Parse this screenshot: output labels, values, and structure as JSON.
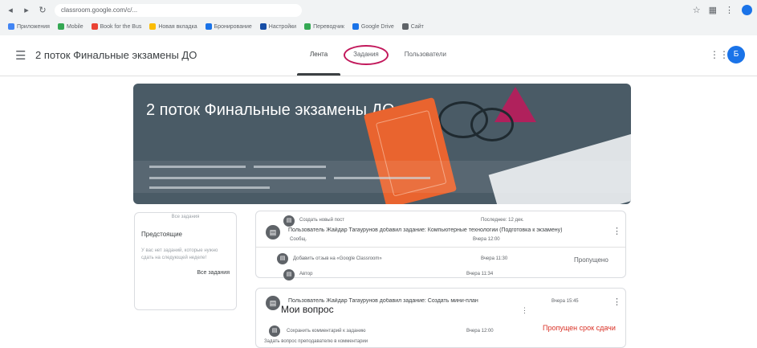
{
  "browser": {
    "url": "classroom.google.com/c/...",
    "bookmarks": [
      {
        "label": "Приложения",
        "color": "#4285f4"
      },
      {
        "label": "Mobile",
        "color": "#34a853"
      },
      {
        "label": "Book for the Bus",
        "color": "#ea4335"
      },
      {
        "label": "Новая вкладка",
        "color": "#fbbc04"
      },
      {
        "label": "Бронирование",
        "color": "#1a73e8"
      },
      {
        "label": "Настройки",
        "color": "#174ea6"
      },
      {
        "label": "Переводчик",
        "color": "#34a853"
      },
      {
        "label": "Google Drive",
        "color": "#1a73e8"
      },
      {
        "label": "Сайт",
        "color": "#5f6368"
      }
    ]
  },
  "header": {
    "course_title": "2 поток Финальные экзамены ДО",
    "tabs": [
      {
        "label": "Лента"
      },
      {
        "label": "Задания"
      },
      {
        "label": "Пользователи"
      }
    ],
    "avatar_letter": "Б"
  },
  "banner": {
    "title": "2 поток Финальные экзамены ДО"
  },
  "sidebar": {
    "top_label": "Все задания",
    "title": "Предстоящие",
    "text": "У вас нет заданий, которые нужно сдать на следующей неделе!",
    "link": "Все задания"
  },
  "stream": {
    "card1": {
      "small_top": "Создать новый пост",
      "small_top_time": "Последнее: 12 дек.",
      "announcement": "Пользователь Жайдар Тагаурунов добавил задание: Компьютерные технологии (Подготовка к экзамену)",
      "sub": "Сообщ.",
      "sub_time": "Вчера 12:00",
      "link_text": "Добавить отзыв на «Google Classroom»",
      "link_meta": "Вчера 11:30",
      "right_action": "Пропущено",
      "footer": "Автор",
      "footer_time": "Вчера 11:34"
    },
    "card2": {
      "announcement": "Пользователь Жайдар Тагаурунов добавил задание: Создать мини-план",
      "time": "Вчера 15:45",
      "question": "Мои вопрос",
      "comment": "Сохранить комментарий к заданию",
      "comment_time": "Вчера 12:00",
      "overdue": "Пропущен срок сдачи",
      "footer_text": "Задать вопрос преподавателю в комментарии"
    }
  }
}
